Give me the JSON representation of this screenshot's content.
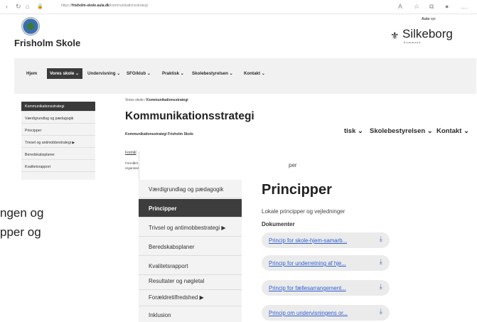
{
  "browser": {
    "url_prefix": "https://",
    "url_host": "frisholm-skole.aula.dk",
    "url_path": "/kommunikationsstrategi",
    "back_icon": "back-icon",
    "forward_icon": "refresh-icon",
    "home_icon": "home-icon"
  },
  "header": {
    "school_name": "Frisholm Skole",
    "auto_label": "Auto",
    "auto_suffix": " opr",
    "municipality": "Silkeborg",
    "municipality_sub": "Kommune"
  },
  "nav": [
    {
      "label": "Hjem"
    },
    {
      "label": "Vores skole ⌄"
    },
    {
      "label": "Undervisning ⌄"
    },
    {
      "label": "SFO/klub ⌄"
    },
    {
      "label": "Praktisk ⌄"
    },
    {
      "label": "Skolebestyrelsen ⌄"
    },
    {
      "label": "Kontakt ⌄"
    }
  ],
  "sidebar1": [
    {
      "label": "Kommunikationsstrategi"
    },
    {
      "label": "Værdigrundlag og pædagogik"
    },
    {
      "label": "Principper"
    },
    {
      "label": "Trivsel og antimobbestrategi ▶"
    },
    {
      "label": "Beredskabsplaner"
    },
    {
      "label": "Kvalitetsrapport"
    }
  ],
  "page1": {
    "crumb_root": "Vores skole",
    "crumb_sep": " / ",
    "crumb_current": "Kommunikationsstrategi",
    "title": "Kommunikationsstrategi",
    "subtitle": "Kommunikationsstrategi Frisholm Skole",
    "link": "Formål",
    "paragraph": "Formålet med skolens kommunikationsstrategi er at skabe en kommunikation mellem skole og hjem, og en ensartet kommunikation i hele organisationen – indhold, hvad der kommunikeres hvor."
  },
  "document": {
    "line1": "ngen og",
    "line2": "pper og"
  },
  "nav2": [
    {
      "label": "tisk ⌄"
    },
    {
      "label": "Skolebestyrelsen ⌄"
    },
    {
      "label": "Kontakt ⌄"
    }
  ],
  "sidebar2": [
    {
      "label": "Værdigrundlag og pædagogik"
    },
    {
      "label": "Principper"
    },
    {
      "label": "Trivsel og antimobbestrategi ▶"
    },
    {
      "label": "Beredskabsplaner"
    },
    {
      "label": "Kvalitetsrapport"
    },
    {
      "label": "Resultater og nøgletal"
    },
    {
      "label": "Forældretilfredshed ▶"
    },
    {
      "label": "Inklusion"
    }
  ],
  "page2": {
    "crumb": "per",
    "title": "Principper",
    "subtitle": "Lokale principper og vejledninger",
    "documents_heading": "Dokumenter",
    "documents": [
      {
        "label": "Princip for skole-hjem-samarb..."
      },
      {
        "label": "Princip for underretning af hje..."
      },
      {
        "label": "Princip for fællesarrangement..."
      },
      {
        "label": "Princip om undervisningens or..."
      }
    ],
    "download_icon": "download-icon"
  },
  "colors": {
    "active_bg": "#3a3a3a",
    "link": "#2e5fd0",
    "nav_bg": "#f1f1f1"
  }
}
